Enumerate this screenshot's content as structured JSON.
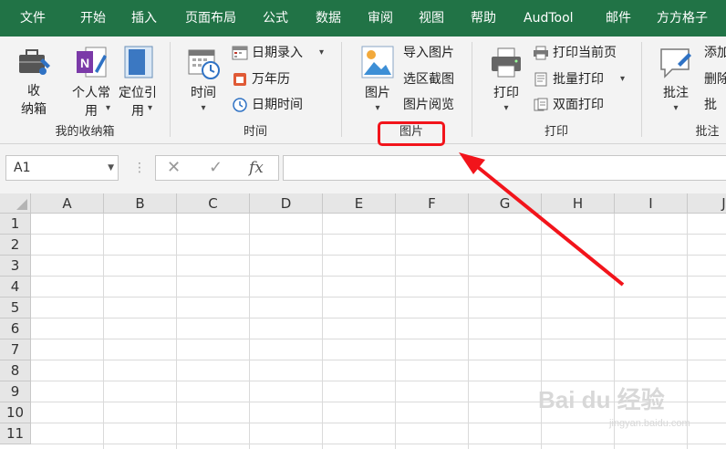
{
  "tabs": [
    "文件",
    "开始",
    "插入",
    "页面布局",
    "公式",
    "数据",
    "审阅",
    "视图",
    "帮助",
    "AudTool",
    "邮件",
    "方方格子"
  ],
  "ribbon": {
    "groups": {
      "storage": {
        "label": "我的收纳箱",
        "btn_storage": [
          "收",
          "纳箱"
        ],
        "btn_personal": [
          "个人常",
          "用"
        ],
        "btn_locate": [
          "定位引",
          "用"
        ]
      },
      "time": {
        "label": "时间",
        "btn_time": "时间",
        "date_entry": "日期录入",
        "calendar": "万年历",
        "datetime": "日期时间"
      },
      "image": {
        "label": "图片",
        "btn_image": "图片",
        "import": "导入图片",
        "capture": "选区截图",
        "browse": "图片阅览"
      },
      "print": {
        "label": "打印",
        "btn_print": "打印",
        "print_current": "打印当前页",
        "batch_print": "批量打印",
        "duplex_print": "双面打印"
      },
      "comment": {
        "label": "批注",
        "btn_comment": "批注",
        "add": "添加",
        "delete": "删除",
        "more": "批"
      }
    }
  },
  "formula_bar": {
    "name_box": "A1",
    "cancel_symbol": "✕",
    "enter_symbol": "✓",
    "fx_symbol": "fx",
    "formula": ""
  },
  "sheet": {
    "columns": [
      "A",
      "B",
      "C",
      "D",
      "E",
      "F",
      "G",
      "H",
      "I",
      "J"
    ],
    "rows": [
      "1",
      "2",
      "3",
      "4",
      "5",
      "6",
      "7",
      "8",
      "9",
      "10",
      "11"
    ]
  },
  "annotation": {
    "color": "#f2141b"
  },
  "watermark": {
    "main": "Bai du 经验",
    "sub": "jingyan.baidu.com"
  },
  "colors": {
    "tab_bar": "#217346",
    "ribbon_bg": "#f3f3f3"
  }
}
